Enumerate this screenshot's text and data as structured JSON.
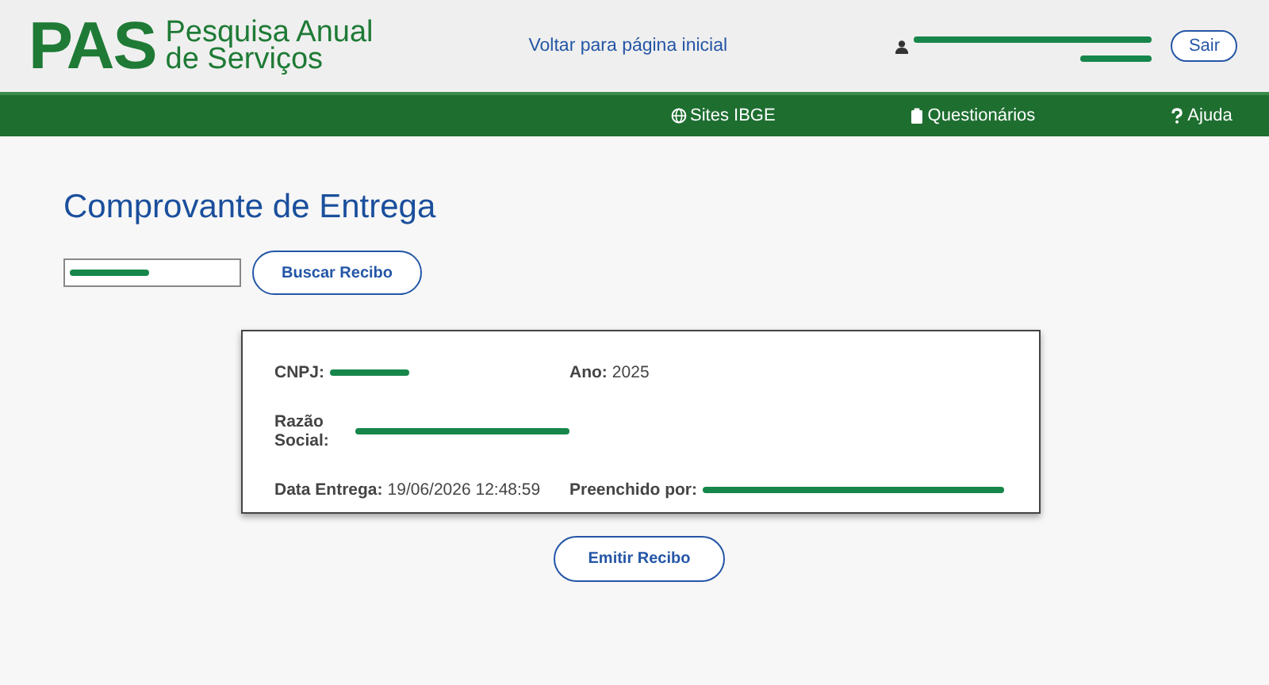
{
  "header": {
    "logo": "PAS",
    "logo_subtitle_1": "Pesquisa Anual",
    "logo_subtitle_2": "de Serviços",
    "home_link": "Voltar para página inicial",
    "user": {
      "redacted": true
    },
    "logout": "Sair"
  },
  "nav": [
    {
      "kind": "globe",
      "label": "Sites IBGE"
    },
    {
      "kind": "clipboard",
      "label": "Questionários"
    },
    {
      "kind": "question",
      "label": "Ajuda"
    }
  ],
  "title": "Comprovante de Entrega",
  "search": {
    "redacted": true,
    "button": "Buscar Recibo"
  },
  "receipt": [
    [
      {
        "label": "CNPJ:",
        "redacted": true
      },
      {
        "label": "Ano:",
        "value": "2025"
      }
    ],
    [
      {
        "label": "Razão Social:",
        "redacted": true
      }
    ],
    [
      {
        "label": "Data Entrega:",
        "value": "19/06/2026 12:48:59"
      },
      {
        "label": "Preenchido por:",
        "redacted": true
      }
    ]
  ],
  "issue_button": "Emitir Recibo"
}
